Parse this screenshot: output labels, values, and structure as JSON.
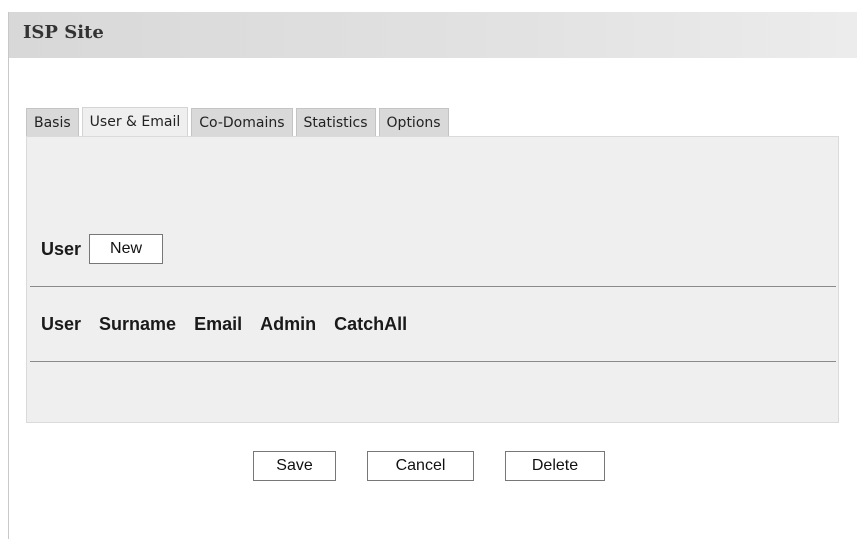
{
  "window": {
    "title": "ISP Site"
  },
  "tabs": [
    {
      "label": "Basis",
      "active": false
    },
    {
      "label": "User & Email",
      "active": true
    },
    {
      "label": "Co-Domains",
      "active": false
    },
    {
      "label": "Statistics",
      "active": false
    },
    {
      "label": "Options",
      "active": false
    }
  ],
  "user_section": {
    "label": "User",
    "new_button": "New"
  },
  "table": {
    "headers": [
      "User",
      "Surname",
      "Email",
      "Admin",
      "CatchAll"
    ],
    "rows": []
  },
  "footer": {
    "save_label": "Save",
    "cancel_label": "Cancel",
    "delete_label": "Delete"
  }
}
